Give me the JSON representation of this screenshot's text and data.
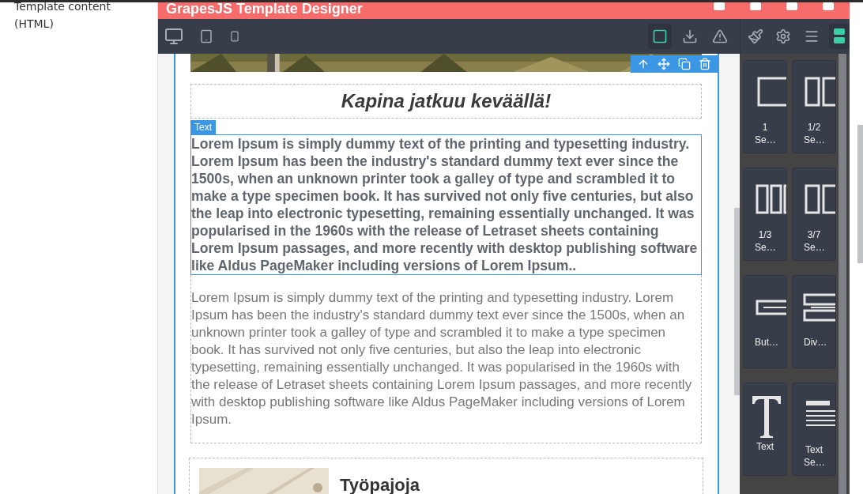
{
  "sidebar": {
    "label": "Template content (HTML)"
  },
  "header": {
    "title": "GrapesJS Template Designer"
  },
  "toolbar": {
    "visibility_active": true
  },
  "canvas": {
    "heading": "Kapina jatkuu keväällä!",
    "badge": "Text",
    "selected_text": "Lorem Ipsum is simply dummy text of the printing and typesetting industry. Lorem Ipsum has been the industry's standard dummy text ever since the 1500s, when an unknown printer took a galley of type and scrambled it to make a type specimen book. It has survived not only five centuries, but also the leap into electronic typesetting, remaining essentially unchanged. It was popularised in the 1960s with the release of Letraset sheets containing Lorem Ipsum passages, and more recently with desktop publishing software like Aldus PageMaker including versions of Lorem Ipsum..",
    "text": "Lorem Ipsum is simply dummy text of the printing and typesetting industry. Lorem Ipsum has been the industry's standard dummy text ever since the 1500s, when an unknown printer took a galley of type and scrambled it to make a type specimen book. It has survived not only five centuries, but also the leap into electronic typesetting, remaining essentially unchanged. It was popularised in the 1960s with the release of Letraset sheets containing Lorem Ipsum passages, and more recently with desktop publishing software like Aldus PageMaker including versions of Lorem Ipsum.",
    "section_title": "Työpajoja"
  },
  "blocks": [
    {
      "kind": "section1",
      "label": "1 Se…"
    },
    {
      "kind": "section2",
      "label": "1/2 Se…"
    },
    {
      "kind": "section3",
      "label": "1/3 Se…"
    },
    {
      "kind": "section37",
      "label": "3/7 Se…"
    },
    {
      "kind": "button",
      "label": "But…"
    },
    {
      "kind": "divider",
      "label": "Div…"
    },
    {
      "kind": "text",
      "label": "Text"
    },
    {
      "kind": "textsection",
      "label": "Text Se…"
    }
  ]
}
